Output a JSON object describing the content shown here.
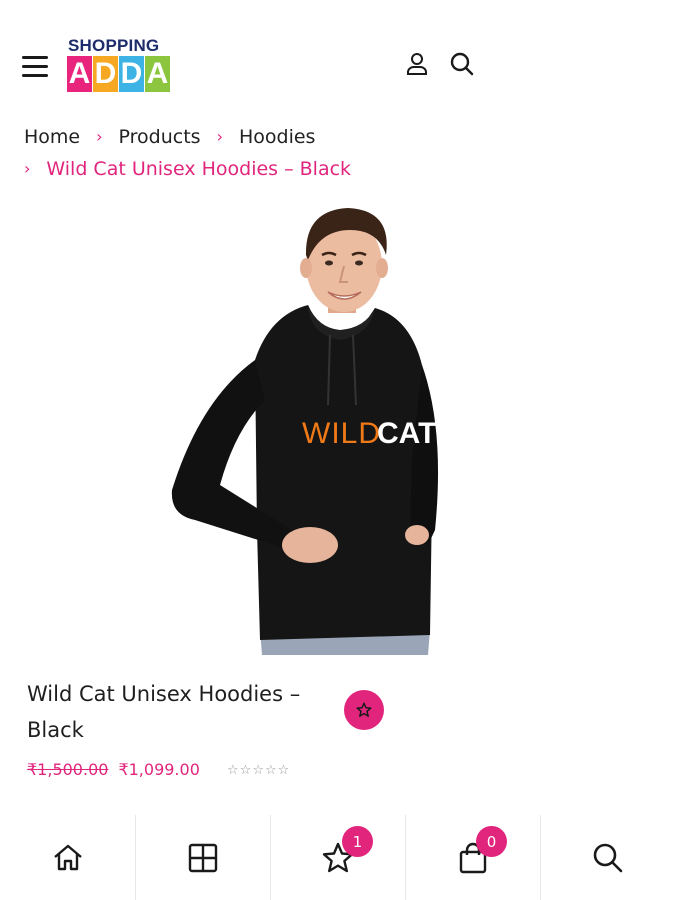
{
  "header": {
    "logo_top": "SHOPPING",
    "logo_letters": [
      "A",
      "D",
      "D",
      "A"
    ],
    "logo_colors": [
      "#e8247c",
      "#f7a823",
      "#3db3e5",
      "#8cc63e"
    ]
  },
  "breadcrumb": {
    "items": [
      "Home",
      "Products",
      "Hoodies"
    ],
    "current": "Wild Cat Unisex Hoodies – Black",
    "separator": "›"
  },
  "product": {
    "title_line1": "Wild Cat Unisex Hoodies –",
    "title_line2": "Black",
    "print_text_1": "WILD",
    "print_text_2": "CAT",
    "price_old": "₹1,500.00",
    "price_new": "₹1,099.00",
    "rating_stars": 5,
    "rating_value": 0
  },
  "bottom_nav": {
    "wishlist_count": "1",
    "cart_count": "0"
  },
  "colors": {
    "accent": "#e1257d"
  }
}
